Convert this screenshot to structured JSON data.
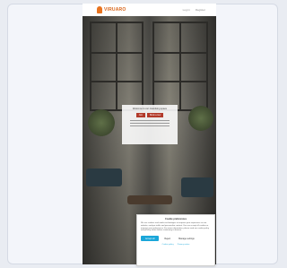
{
  "site": {
    "logo_text": "VIRUARO",
    "nav": [
      "Log in",
      "Register"
    ]
  },
  "hero_overlay": {
    "title": "Welcome to our coworking space",
    "primary_button": "Join",
    "secondary_button": "Book a tour"
  },
  "consent": {
    "title": "Cookie preferences",
    "text": "We use cookies and similar technologies to improve your experience on our website, analyse traffic and personalise content. You can accept all cookies or manage your preferences. For more information, please read our cookie policy and privacy notice before continuing to browse.",
    "accept_label": "Accept all",
    "reject_label": "Reject",
    "settings_label": "Manage settings",
    "links": [
      "Cookie policy",
      "Privacy notice"
    ]
  },
  "colors": {
    "brand": "#e8731f",
    "accent": "#1aa6d9",
    "overlay_button": "#b23a2a"
  }
}
